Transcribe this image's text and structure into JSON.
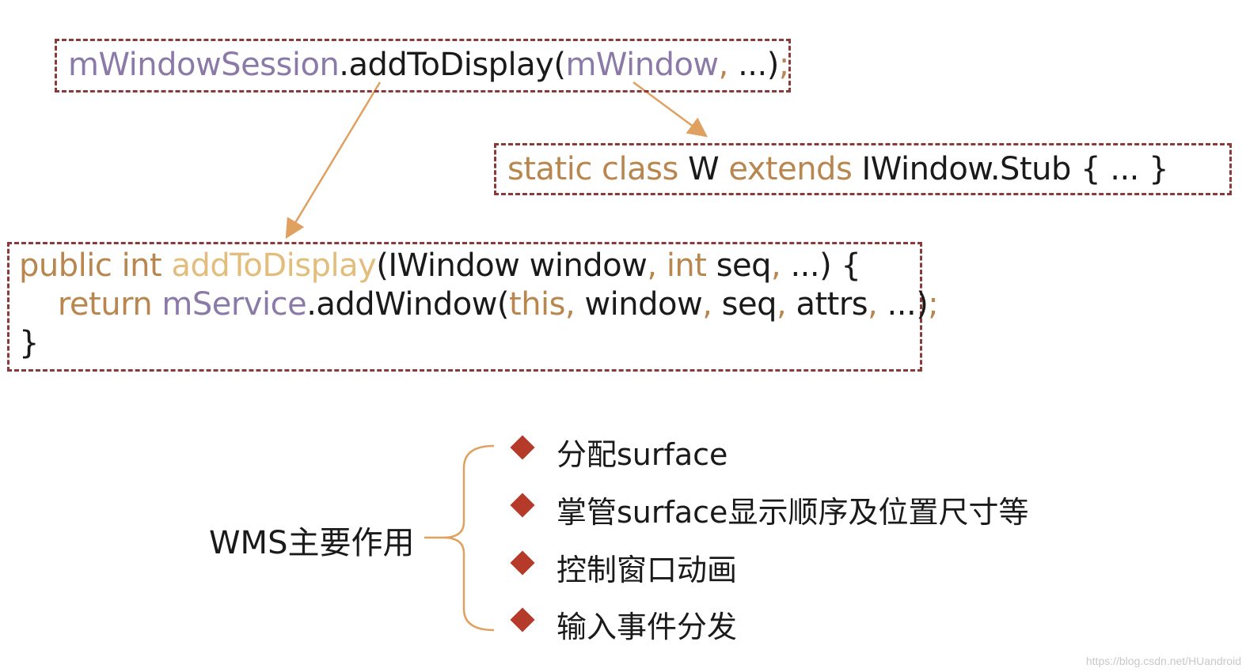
{
  "box1": {
    "tokens": [
      {
        "text": "mWindowSession",
        "cls": "purple"
      },
      {
        "text": ".addToDisplay(",
        "cls": "dark"
      },
      {
        "text": "mWindow",
        "cls": "purple"
      },
      {
        "text": ", ",
        "cls": "orange"
      },
      {
        "text": "...)",
        "cls": "dark"
      },
      {
        "text": ";",
        "cls": "orange"
      }
    ]
  },
  "box2": {
    "tokens": [
      {
        "text": "static class ",
        "cls": "orange"
      },
      {
        "text": "W ",
        "cls": "dark"
      },
      {
        "text": "extends ",
        "cls": "orange"
      },
      {
        "text": "IWindow.Stub { ... }",
        "cls": "dark"
      }
    ]
  },
  "box3": {
    "lines": [
      [
        {
          "text": "public int ",
          "cls": "orange"
        },
        {
          "text": "addToDisplay",
          "cls": "gold"
        },
        {
          "text": "(IWindow window",
          "cls": "dark"
        },
        {
          "text": ", ",
          "cls": "orange"
        },
        {
          "text": "int ",
          "cls": "orange"
        },
        {
          "text": "seq",
          "cls": "dark"
        },
        {
          "text": ", ",
          "cls": "orange"
        },
        {
          "text": "...) {",
          "cls": "dark"
        }
      ],
      [
        {
          "text": "    return ",
          "cls": "orange"
        },
        {
          "text": "mService",
          "cls": "purple"
        },
        {
          "text": ".addWindow(",
          "cls": "dark"
        },
        {
          "text": "this",
          "cls": "orange"
        },
        {
          "text": ", ",
          "cls": "orange"
        },
        {
          "text": "window",
          "cls": "dark"
        },
        {
          "text": ", ",
          "cls": "orange"
        },
        {
          "text": "seq",
          "cls": "dark"
        },
        {
          "text": ", ",
          "cls": "orange"
        },
        {
          "text": "attrs",
          "cls": "dark"
        },
        {
          "text": ", ",
          "cls": "orange"
        },
        {
          "text": "...)",
          "cls": "dark"
        },
        {
          "text": ";",
          "cls": "orange"
        }
      ],
      [
        {
          "text": "}",
          "cls": "dark"
        }
      ]
    ]
  },
  "wms": {
    "label": "WMS主要作用",
    "items": [
      "分配surface",
      "掌管surface显示顺序及位置尺寸等",
      "控制窗口动画",
      "输入事件分发"
    ]
  },
  "colors": {
    "box_border": "#8b3a3a",
    "arrow": "#e0a060",
    "diamond": "#b53a2a"
  },
  "watermark": "https://blog.csdn.net/HUandroid"
}
